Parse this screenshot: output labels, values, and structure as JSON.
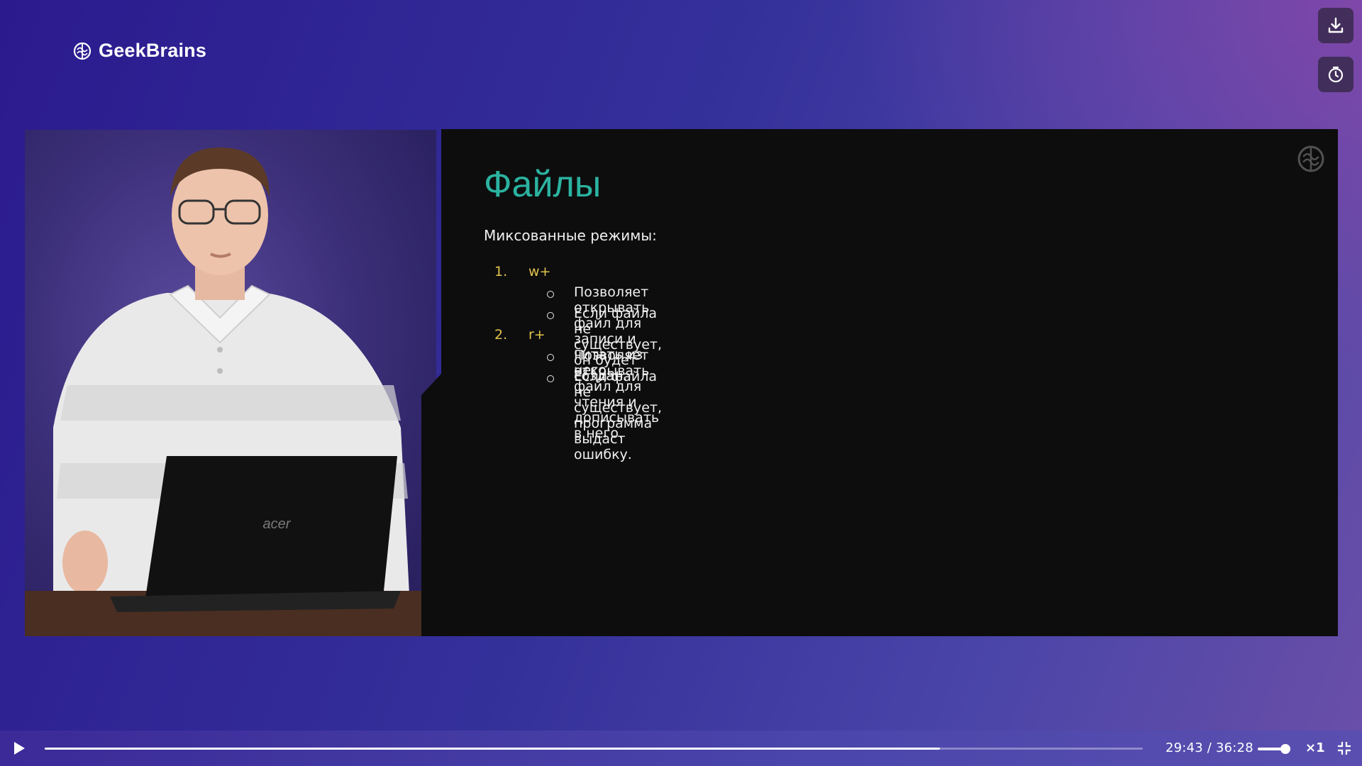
{
  "brand": {
    "name": "GeekBrains",
    "logo_icon": "brain-logo-icon"
  },
  "side_buttons": [
    {
      "icon": "download-icon"
    },
    {
      "icon": "timer-icon"
    }
  ],
  "presenter": {
    "laptop_brand": "acer"
  },
  "slide": {
    "title": "Файлы",
    "intro": "Миксованные режимы:",
    "items": [
      {
        "num": "1.",
        "mode": "w+",
        "bullets": [
          "Позволяет открывать файл для записи и читать из него.",
          "Если файла не существует, он будет создан."
        ]
      },
      {
        "num": "2.",
        "mode": "r+",
        "bullets": [
          "Позволяет открывать файл для чтения и дописывать в него.",
          "Если файла не существует, программа выдаст ошибку."
        ]
      }
    ],
    "colors": {
      "title": "#2bb3a0",
      "mode": "#e2c44a",
      "background": "#0d0d0e"
    }
  },
  "player": {
    "current_time": "29:43",
    "separator": "/",
    "duration": "36:28",
    "progress_fraction": 0.815,
    "volume_fraction": 1.0,
    "speed": "×1",
    "play_icon": "play-icon",
    "fullscreen_icon": "exit-fullscreen-icon"
  }
}
